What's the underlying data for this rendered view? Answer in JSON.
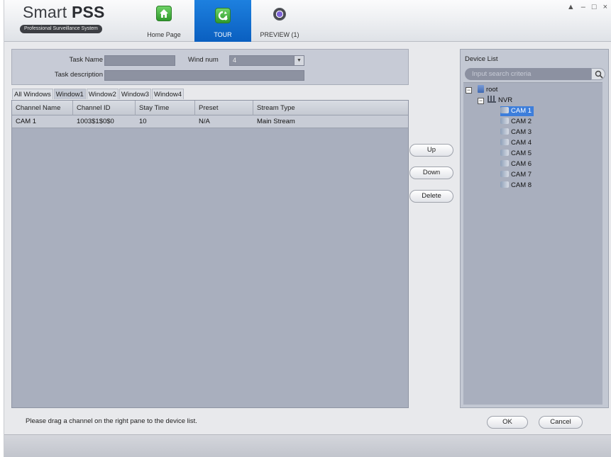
{
  "app": {
    "title_prefix": "Smart ",
    "title_bold": "PSS",
    "subtitle": "Professional Surveillance System"
  },
  "nav": {
    "home": "Home Page",
    "tour": "TOUR",
    "preview": "PREVIEW (1)"
  },
  "window_controls": [
    "▲",
    "–",
    "□",
    "×"
  ],
  "task_form": {
    "task_name_label": "Task Name",
    "task_name_value": "",
    "wind_num_label": "Wind num",
    "wind_num_value": "4",
    "task_description_label": "Task description",
    "task_description_value": ""
  },
  "window_tabs": [
    "All Windows",
    "Window1",
    "Window2",
    "Window3",
    "Window4"
  ],
  "active_window_tab": "Window1",
  "grid": {
    "columns": [
      "Channel Name",
      "Channel ID",
      "Stay Time",
      "Preset",
      "Stream Type"
    ],
    "rows": [
      [
        "CAM 1",
        "1003$1$0$0",
        "10",
        "N/A",
        "Main Stream"
      ]
    ]
  },
  "actions": {
    "up": "Up",
    "down": "Down",
    "delete": "Delete",
    "ok": "OK",
    "cancel": "Cancel"
  },
  "hint": "Please drag a channel on the right pane to the device list.",
  "device_list": {
    "title": "Device List",
    "search_placeholder": "Input search criteria",
    "root": "root",
    "device": "NVR",
    "cameras": [
      "CAM 1",
      "CAM 2",
      "CAM 3",
      "CAM 4",
      "CAM 5",
      "CAM 6",
      "CAM 7",
      "CAM 8"
    ],
    "selected": "CAM 1"
  },
  "colors": {
    "tour_tab": "#0a6ad0",
    "panel_bg": "#c3c8d3",
    "grid_bg": "#a9afbe",
    "selection": "#3d7edb"
  },
  "icons": {
    "home": "home-icon",
    "tour": "tour-icon",
    "preview": "camera-lens-icon",
    "search": "magnifier-icon"
  }
}
